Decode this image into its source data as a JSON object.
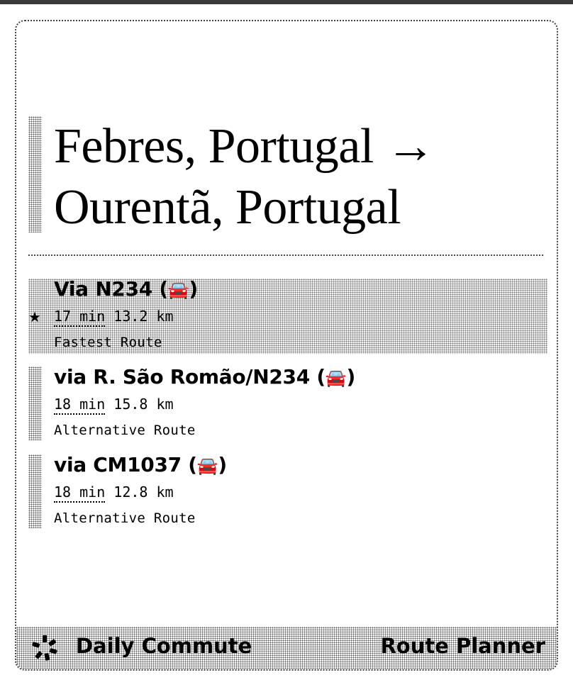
{
  "header": {
    "title_line1": "Febres, Portugal →",
    "title_line2": "Ourentã, Portugal"
  },
  "routes": [
    {
      "name": "Via N234",
      "mode_icon": "🚘",
      "time": "17 min",
      "distance": "13.2 km",
      "label": "Fastest Route",
      "selected": true
    },
    {
      "name": "via R. São Romão/N234",
      "mode_icon": "🚘",
      "time": "18 min",
      "distance": "15.8 km",
      "label": "Alternative Route",
      "selected": false
    },
    {
      "name": "via CM1037",
      "mode_icon": "🚘",
      "time": "18 min",
      "distance": "12.8 km",
      "label": "Alternative Route",
      "selected": false
    }
  ],
  "selected_marker": "★",
  "footer": {
    "brand": "Daily Commute",
    "product": "Route Planner"
  }
}
